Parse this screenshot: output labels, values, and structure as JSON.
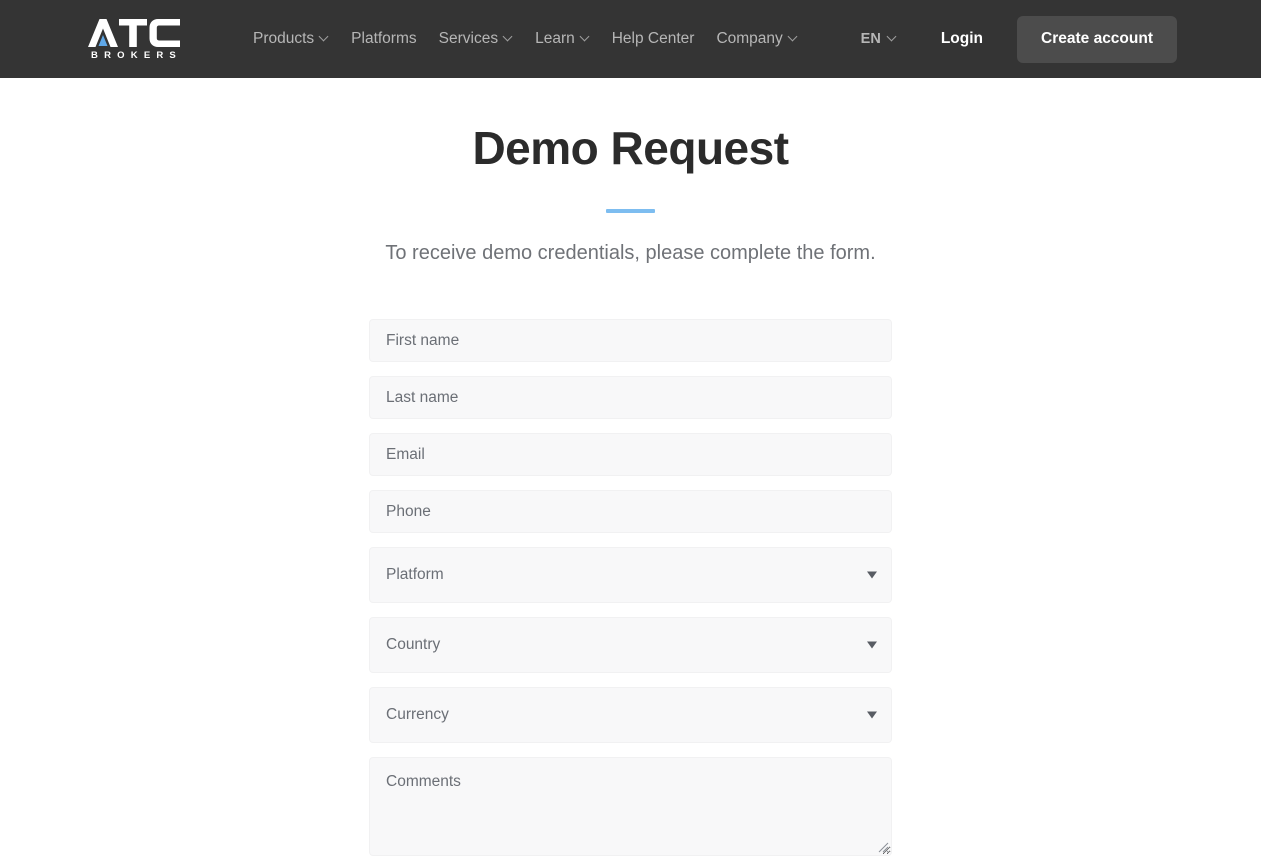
{
  "header": {
    "logo": {
      "mark_text": "ATC",
      "sub_text": "BROKERS",
      "accent_color": "#5FA8E8"
    },
    "nav": [
      {
        "label": "Products",
        "has_caret": true
      },
      {
        "label": "Platforms",
        "has_caret": false
      },
      {
        "label": "Services",
        "has_caret": true
      },
      {
        "label": "Learn",
        "has_caret": true
      },
      {
        "label": "Help Center",
        "has_caret": false
      },
      {
        "label": "Company",
        "has_caret": true
      }
    ],
    "language": "EN",
    "login_label": "Login",
    "create_account_label": "Create account",
    "background_color": "#343434"
  },
  "main": {
    "title": "Demo Request",
    "accent_color": "#7DBDF0",
    "subtitle": "To receive demo credentials, please complete the form."
  },
  "form": {
    "fields": [
      {
        "type": "text",
        "name": "first-name",
        "placeholder": "First name"
      },
      {
        "type": "text",
        "name": "last-name",
        "placeholder": "Last name"
      },
      {
        "type": "text",
        "name": "email",
        "placeholder": "Email"
      },
      {
        "type": "text",
        "name": "phone",
        "placeholder": "Phone"
      },
      {
        "type": "select",
        "name": "platform",
        "placeholder": "Platform"
      },
      {
        "type": "select",
        "name": "country",
        "placeholder": "Country"
      },
      {
        "type": "select",
        "name": "currency",
        "placeholder": "Currency"
      },
      {
        "type": "textarea",
        "name": "comments",
        "placeholder": "Comments"
      }
    ],
    "field_values": {
      "first_name": "",
      "last_name": "",
      "email": "",
      "phone": "",
      "platform": "Platform",
      "country": "Country",
      "currency": "Currency",
      "comments": ""
    }
  }
}
